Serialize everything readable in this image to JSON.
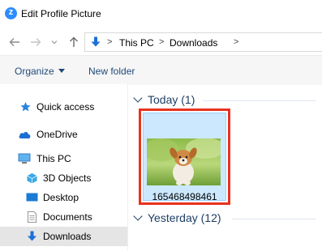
{
  "window": {
    "title": "Edit Profile Picture",
    "app_icon": "zoom-icon"
  },
  "nav": {
    "back_icon": "arrow-left-icon",
    "forward_icon": "arrow-right-icon",
    "recent_icon": "chevron-down-icon",
    "up_icon": "arrow-up-icon"
  },
  "address": {
    "breadcrumbs": [
      "This PC",
      "Downloads"
    ],
    "separator": ">"
  },
  "toolbar": {
    "organize": "Organize",
    "new_folder": "New folder"
  },
  "sidebar": {
    "items": [
      {
        "label": "Quick access",
        "icon": "star-icon"
      },
      {
        "label": "OneDrive",
        "icon": "cloud-icon"
      },
      {
        "label": "This PC",
        "icon": "computer-icon"
      },
      {
        "label": "3D Objects",
        "icon": "cube-icon"
      },
      {
        "label": "Desktop",
        "icon": "desktop-icon"
      },
      {
        "label": "Documents",
        "icon": "document-icon"
      },
      {
        "label": "Downloads",
        "icon": "download-icon",
        "selected": true
      }
    ]
  },
  "content": {
    "groups": [
      {
        "label": "Today (1)"
      },
      {
        "label": "Yesterday (12)"
      }
    ],
    "files": [
      {
        "name": "165468498461",
        "selected": true
      }
    ]
  },
  "colors": {
    "highlight": "#e8321e",
    "selection": "#cce8ff",
    "accent": "#1e3f66"
  }
}
